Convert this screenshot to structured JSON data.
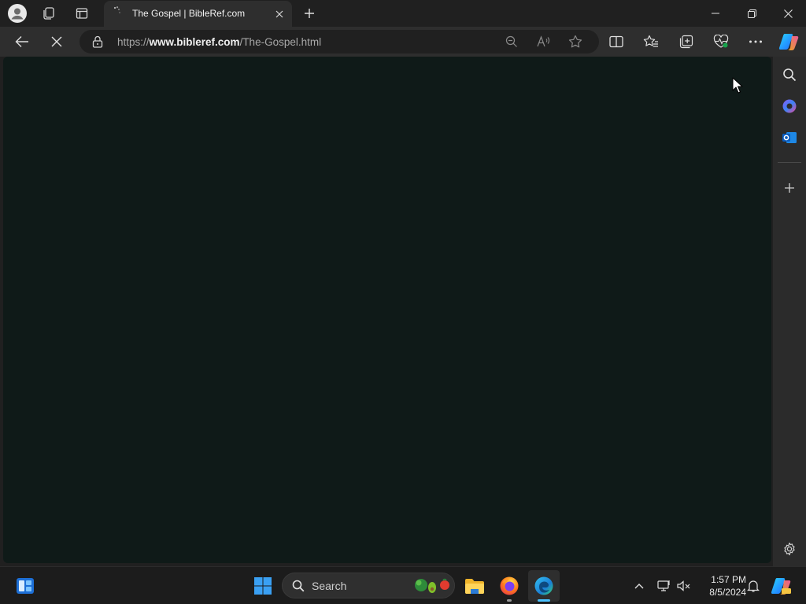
{
  "browser": {
    "tab": {
      "title": "The Gospel | BibleRef.com"
    },
    "address": {
      "scheme": "https://",
      "host": "www.bibleref.com",
      "path": "/The-Gospel.html"
    }
  },
  "taskbar": {
    "search_label": "Search",
    "time": "1:57 PM",
    "date": "8/5/2024"
  },
  "colors": {
    "page_background": "#0f1a18",
    "browser_chrome": "#2e2e2e",
    "taskbar": "#1c1c1c"
  }
}
